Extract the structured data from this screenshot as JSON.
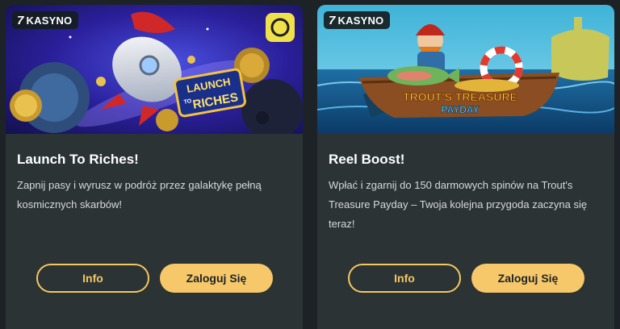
{
  "brand": {
    "badge_symbol": "7",
    "badge_label": "KASYNO"
  },
  "cards": [
    {
      "title": "Launch To Riches!",
      "description": "Zapnij pasy i wyrusz w podróż przez galaktykę pełną kosmicznych skarbów!",
      "banner_logo_line1": "LAUNCH",
      "banner_logo_line2": "TO",
      "banner_logo_line3": "RICHES",
      "info_label": "Info",
      "login_label": "Zaloguj Się"
    },
    {
      "title": "Reel Boost!",
      "description": "Wpłać i zgarnij do 150 darmowych spinów na Trout's Treasure Payday – Twoja kolejna przygoda zaczyna się teraz!",
      "banner_logo_line1": "TROUT'S TREASURE",
      "banner_logo_line2": "PAYDAY",
      "info_label": "Info",
      "login_label": "Zaloguj Się"
    }
  ],
  "colors": {
    "accent": "#f6c86a",
    "card_bg": "#2b3335",
    "page_bg": "#1c2225"
  }
}
